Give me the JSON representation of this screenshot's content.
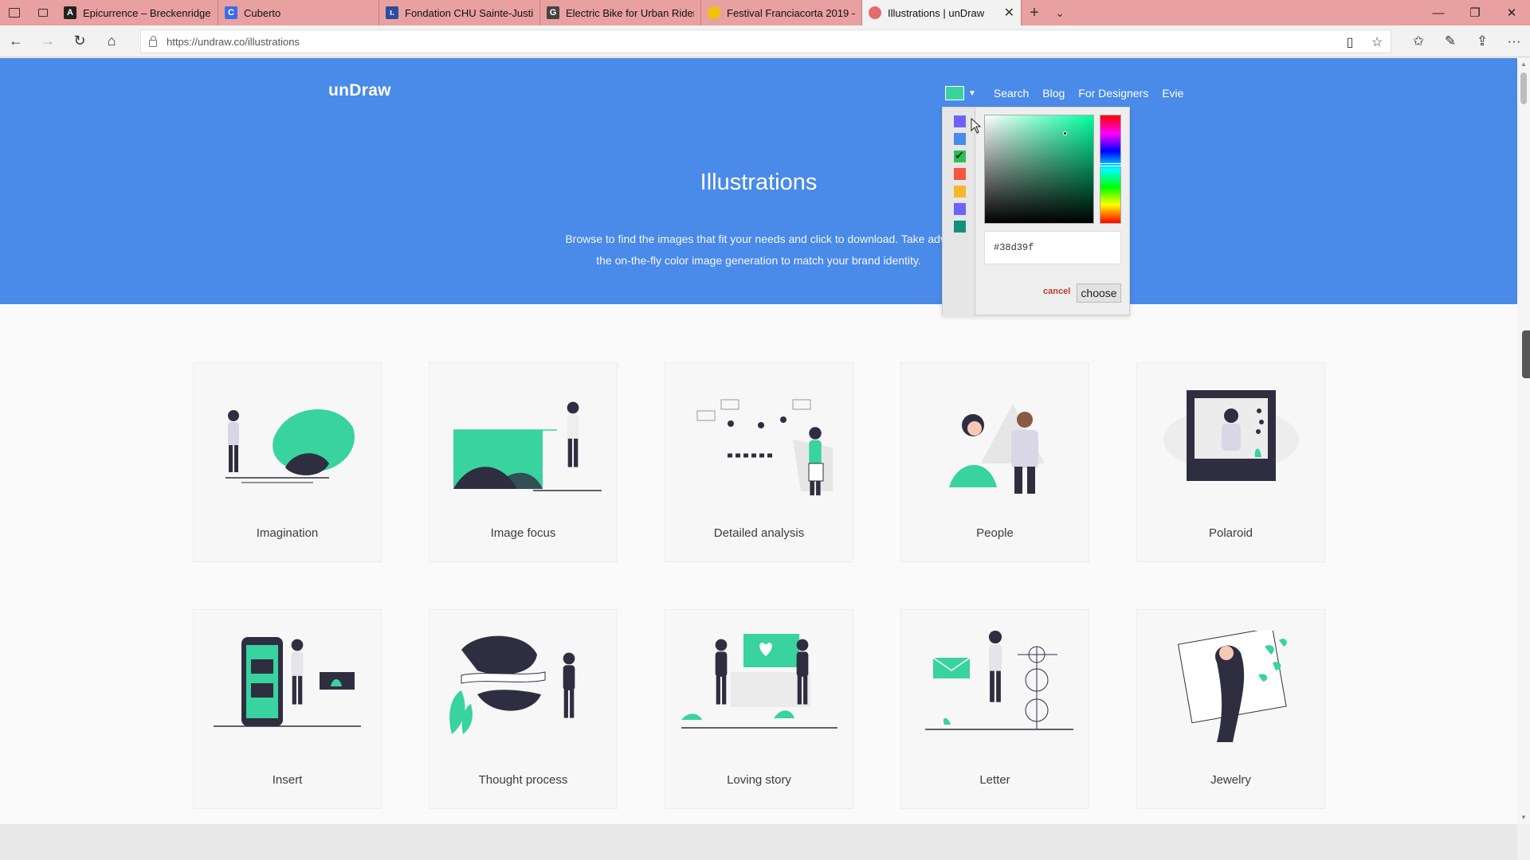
{
  "browser": {
    "tabs": [
      {
        "title": "Epicurrence – Breckenridge,",
        "favicon_color": "#222222",
        "favicon_glyph": "A"
      },
      {
        "title": "Cuberto",
        "favicon_color": "#3d6ce8",
        "favicon_glyph": "C"
      },
      {
        "title": "Fondation CHU Sainte-Justi",
        "favicon_color": "#2b4ea0",
        "favicon_glyph": "ı."
      },
      {
        "title": "Electric Bike for Urban Rider",
        "favicon_color": "#444444",
        "favicon_glyph": "G"
      },
      {
        "title": "Festival Franciacorta 2019 –",
        "favicon_color": "#f2c200",
        "favicon_glyph": ""
      },
      {
        "title": "Illustrations | unDraw",
        "favicon_color": "#e46b6b",
        "favicon_glyph": ""
      }
    ],
    "active_tab_index": 5,
    "url": "https://undraw.co/illustrations",
    "tab_bar_color": "#e9a0a0"
  },
  "site": {
    "logo": "unDraw",
    "nav": [
      "Search",
      "Blog",
      "For Designers",
      "Evie"
    ],
    "accent_color": "#38d39f",
    "hero_color": "#4a8ae8",
    "hero_title": "Illustrations",
    "hero_subtitle": "Browse to find the images that fit your needs and click to download. Take adva\nthe on-the-fly color image generation to match your brand identity."
  },
  "color_picker": {
    "presets": [
      "#6c63ff",
      "#4a8ae8",
      "#2ebd59",
      "#f5563d",
      "#f5b82e",
      "#6c63ff",
      "#138f7e"
    ],
    "checked_index": 2,
    "hex_value": "#38d39f",
    "cancel_label": "cancel",
    "choose_label": "choose"
  },
  "illustrations": [
    {
      "label": "Imagination"
    },
    {
      "label": "Image focus"
    },
    {
      "label": "Detailed analysis"
    },
    {
      "label": "People"
    },
    {
      "label": "Polaroid"
    },
    {
      "label": "Insert"
    },
    {
      "label": "Thought process"
    },
    {
      "label": "Loving story"
    },
    {
      "label": "Letter"
    },
    {
      "label": "Jewelry"
    }
  ],
  "icons": {
    "back": "arrow-left-icon",
    "forward": "arrow-right-icon",
    "refresh": "refresh-icon",
    "home": "home-icon",
    "reading_view": "reading-view-icon",
    "favorite": "star-icon",
    "favorites_list": "favorites-icon",
    "notes": "pen-icon",
    "share": "share-icon",
    "more": "more-icon"
  }
}
